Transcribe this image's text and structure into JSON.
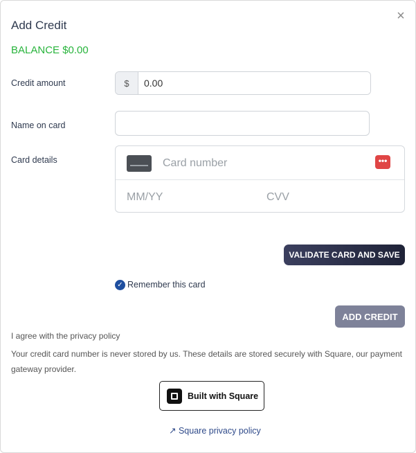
{
  "dialog": {
    "title": "Add Credit",
    "close_glyph": "×",
    "balance": "BALANCE $0.00"
  },
  "form": {
    "credit_amount_label": "Credit amount",
    "currency_symbol": "$",
    "credit_amount_value": "0.00",
    "name_on_card_label": "Name on card",
    "name_on_card_value": "",
    "card_details_label": "Card details",
    "card_number_placeholder": "Card number",
    "expiry_placeholder": "MM/YY",
    "cvv_placeholder": "CVV",
    "card_error_glyph": "•••"
  },
  "actions": {
    "validate_label": "VALIDATE CARD AND SAVE",
    "remember_label": "Remember this card",
    "remember_checked": true,
    "add_credit_label": "ADD CREDIT"
  },
  "footer": {
    "agree_text": "I agree with the privacy policy",
    "notice_text": "Your credit card number is never stored by us. These details are stored securely with Square, our payment gateway provider.",
    "square_badge_label": "Built with Square",
    "privacy_link_label": "Square privacy policy"
  },
  "icons": {
    "close": "close-icon",
    "card": "credit-card-icon",
    "error": "card-error-icon",
    "check": "checkmark-icon",
    "square": "square-logo-icon",
    "external_link": "external-link-icon"
  },
  "colors": {
    "balance": "#28b43c",
    "validate_button": "#2a2e48",
    "add_credit_button": "#7e8299",
    "checkbox": "#1f4fa0",
    "error_icon": "#e04545"
  }
}
